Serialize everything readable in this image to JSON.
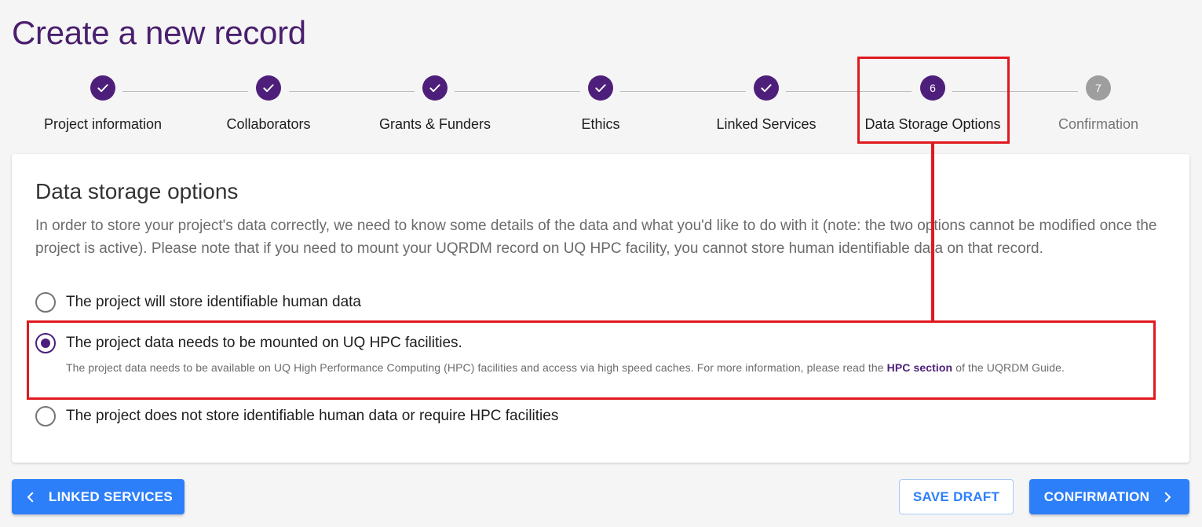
{
  "page": {
    "title": "Create a new record"
  },
  "stepper": {
    "steps": [
      {
        "label": "Project information",
        "state": "done",
        "number": "1"
      },
      {
        "label": "Collaborators",
        "state": "done",
        "number": "2"
      },
      {
        "label": "Grants & Funders",
        "state": "done",
        "number": "3"
      },
      {
        "label": "Ethics",
        "state": "done",
        "number": "4"
      },
      {
        "label": "Linked Services",
        "state": "done",
        "number": "5"
      },
      {
        "label": "Data Storage Options",
        "state": "active",
        "number": "6"
      },
      {
        "label": "Confirmation",
        "state": "inactive",
        "number": "7"
      }
    ]
  },
  "card": {
    "title": "Data storage options",
    "description": "In order to store your project's data correctly, we need to know some details of the data and what you'd like to do with it (note: the two options cannot be modified once the project is active). Please note that if you need to mount your UQRDM record on UQ HPC facility, you cannot store human identifiable data on that record.",
    "options": [
      {
        "label": "The project will store identifiable human data",
        "checked": false
      },
      {
        "label": "The project data needs to be mounted on UQ HPC facilities.",
        "checked": true,
        "help_before": "The project data needs to be available on UQ High Performance Computing (HPC) facilities and access via high speed caches. For more information, please read the ",
        "help_link": "HPC section",
        "help_after": " of the UQRDM Guide."
      },
      {
        "label": "The project does not store identifiable human data or require HPC facilities",
        "checked": false
      }
    ]
  },
  "buttons": {
    "back_label": "LINKED SERVICES",
    "save_label": "SAVE DRAFT",
    "next_label": "CONFIRMATION"
  },
  "colors": {
    "accent": "#4e1f7a",
    "primary_button": "#2d7ff9",
    "highlight": "#e0191f",
    "inactive_step": "#9e9e9e"
  }
}
